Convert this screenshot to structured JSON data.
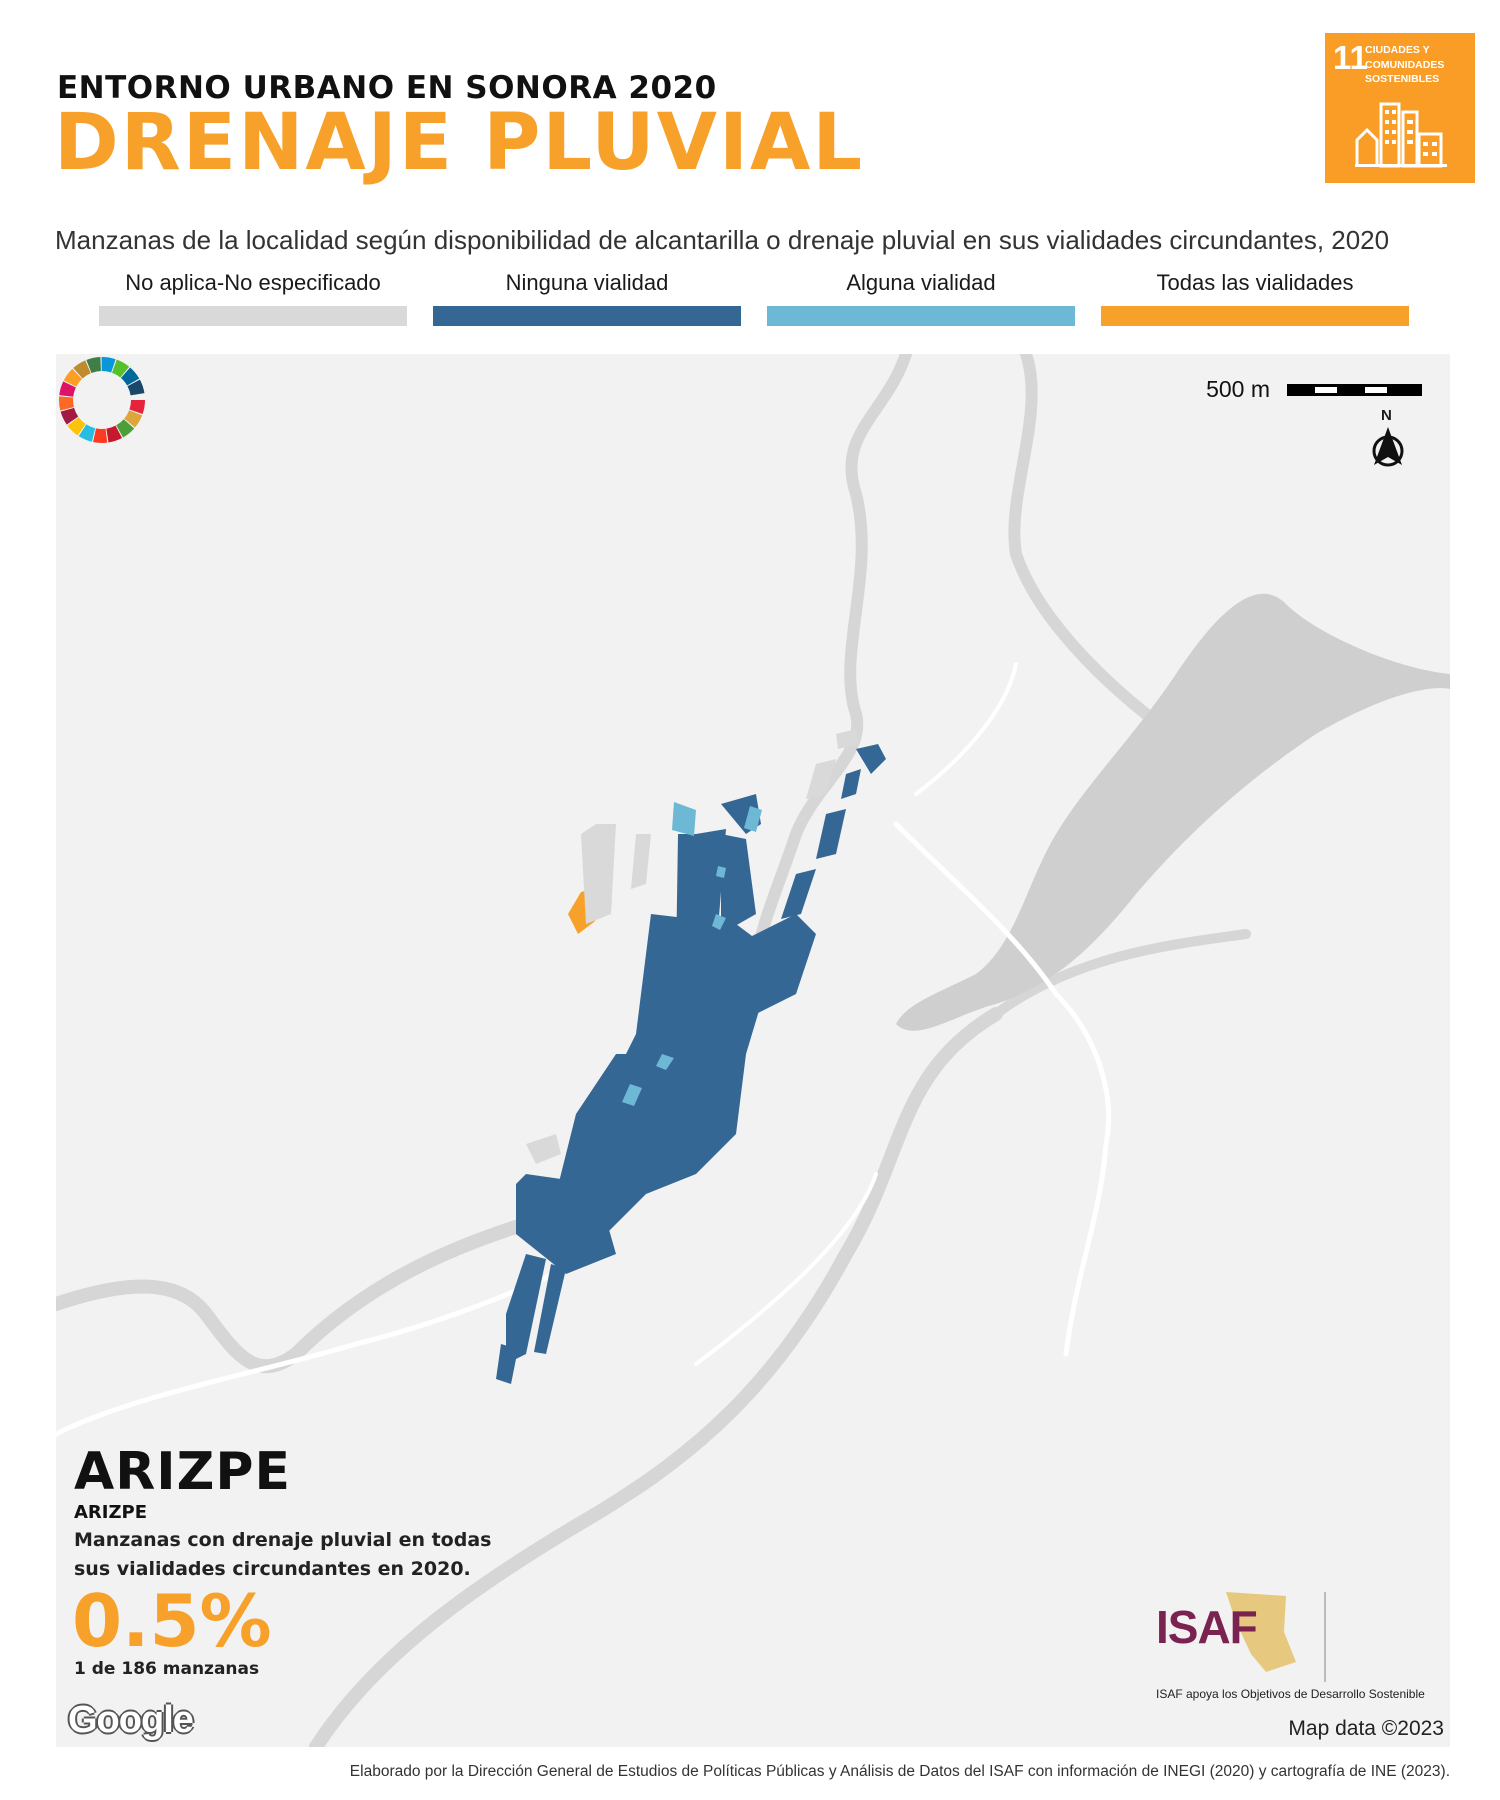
{
  "header": {
    "supertitle": "ENTORNO URBANO EN SONORA 2020",
    "title": "DRENAJE PLUVIAL",
    "subtitle": "Manzanas de la localidad según disponibilidad de alcantarilla o drenaje pluvial en sus vialidades circundantes, 2020"
  },
  "sdg_badge": {
    "number": "11",
    "text": "CIUDADES Y COMUNIDADES SOSTENIBLES",
    "color": "#f99d26"
  },
  "legend": [
    {
      "label": "No aplica-No especificado",
      "color": "#d9d9d9"
    },
    {
      "label": "Ninguna vialidad",
      "color": "#356795"
    },
    {
      "label": "Alguna vialidad",
      "color": "#6db8d5"
    },
    {
      "label": "Todas las vialidades",
      "color": "#f7a12b"
    }
  ],
  "map": {
    "scale_label": "500 m",
    "north_label": "N",
    "locality": "ARIZPE",
    "municipality": "ARIZPE",
    "stat_description": "Manzanas con drenaje pluvial en todas sus vialidades circundantes en 2020.",
    "stat_value": "0.5%",
    "stat_count": "1 de 186 manzanas",
    "provider_logo": "Google",
    "attribution": "Map data ©2023",
    "background_color": "#f2f2f2",
    "water_color": "#d0d0d0",
    "road_color": "#ffffff"
  },
  "logos": {
    "isaf": "ISAF",
    "isaf_caption": "ISAF apoya los Objetivos de Desarrollo Sostenible"
  },
  "footer": "Elaborado por la Dirección General de Estudios de Políticas Públicas y Análisis de Datos del ISAF con información de INEGI (2020) y cartografía de INE (2023)."
}
